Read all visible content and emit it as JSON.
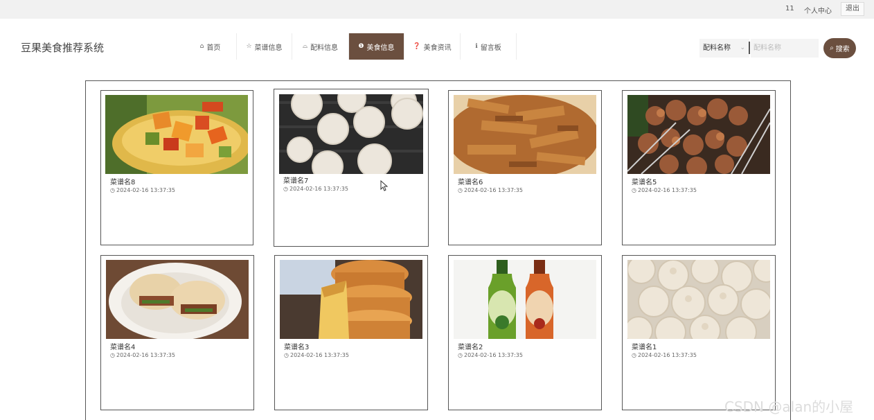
{
  "topbar": {
    "user_id": "11",
    "user_center": "个人中心",
    "logout": "退出"
  },
  "site": {
    "title": "豆果美食推荐系统"
  },
  "nav": {
    "items": [
      {
        "label": "首页",
        "icon": "home-icon",
        "glyph": "⌂"
      },
      {
        "label": "菜谱信息",
        "icon": "star-icon",
        "glyph": "☆"
      },
      {
        "label": "配料信息",
        "icon": "bag-icon",
        "glyph": "⌓"
      },
      {
        "label": "美食信息",
        "icon": "info-icon",
        "glyph": "❶"
      },
      {
        "label": "美食资讯",
        "icon": "question-icon",
        "glyph": "❓"
      },
      {
        "label": "留言板",
        "icon": "info-icon",
        "glyph": "ℹ"
      }
    ],
    "active_index": 3
  },
  "search": {
    "select_value": "配料名称",
    "placeholder": "配料名称",
    "button_label": "搜索"
  },
  "cards": [
    {
      "name": "菜谱名8",
      "date": "2024-02-16 13:37:35",
      "image": "pineapple-stirfry-photo"
    },
    {
      "name": "菜谱名7",
      "date": "2024-02-16 13:37:35",
      "image": "mooncake-tray-photo"
    },
    {
      "name": "菜谱名6",
      "date": "2024-02-16 13:37:35",
      "image": "braised-meat-photo"
    },
    {
      "name": "菜谱名5",
      "date": "2024-02-16 13:37:35",
      "image": "meat-skewers-photo"
    },
    {
      "name": "菜谱名4",
      "date": "2024-02-16 13:37:35",
      "image": "roujiamo-photo"
    },
    {
      "name": "菜谱名3",
      "date": "2024-02-16 13:37:35",
      "image": "egg-tarts-photo"
    },
    {
      "name": "菜谱名2",
      "date": "2024-02-16 13:37:35",
      "image": "juice-bottles-photo"
    },
    {
      "name": "菜谱名1",
      "date": "2024-02-16 13:37:35",
      "image": "dumplings-photo"
    }
  ],
  "watermark": "CSDN @alan的小屋",
  "colors": {
    "accent": "#6b4f3f",
    "topbar_bg": "#f1f1f1"
  }
}
